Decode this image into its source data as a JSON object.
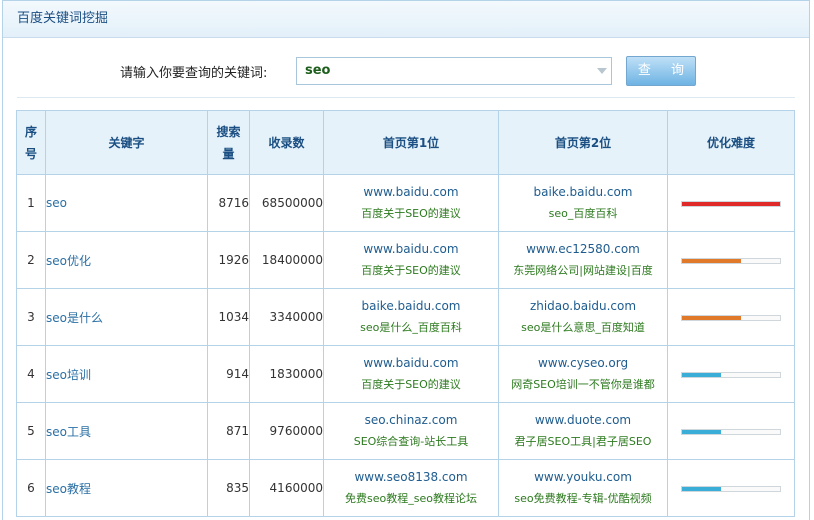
{
  "header": {
    "title": "百度关键词挖掘"
  },
  "search": {
    "label": "请输入你要查询的关键词:",
    "value": "seo",
    "button_label": "查 询"
  },
  "table": {
    "columns": [
      "序号",
      "关键字",
      "搜索量",
      "收录数",
      "首页第1位",
      "首页第2位",
      "优化难度"
    ],
    "rows": [
      {
        "index": "1",
        "keyword": "seo",
        "search_volume": "8716",
        "indexed": "68500000",
        "first_domain": "www.baidu.com",
        "first_title": "百度关于SEO的建议",
        "second_domain": "baike.baidu.com",
        "second_title": "seo_百度百科",
        "difficulty": 1.0,
        "difficulty_color": "#e02a2a"
      },
      {
        "index": "2",
        "keyword": "seo优化",
        "search_volume": "1926",
        "indexed": "18400000",
        "first_domain": "www.baidu.com",
        "first_title": "百度关于SEO的建议",
        "second_domain": "www.ec12580.com",
        "second_title": "东莞网络公司|网站建设|百度",
        "difficulty": 0.6,
        "difficulty_color": "#e07a2a"
      },
      {
        "index": "3",
        "keyword": "seo是什么",
        "search_volume": "1034",
        "indexed": "3340000",
        "first_domain": "baike.baidu.com",
        "first_title": "seo是什么_百度百科",
        "second_domain": "zhidao.baidu.com",
        "second_title": "seo是什么意思_百度知道",
        "difficulty": 0.6,
        "difficulty_color": "#e07a2a"
      },
      {
        "index": "4",
        "keyword": "seo培训",
        "search_volume": "914",
        "indexed": "1830000",
        "first_domain": "www.baidu.com",
        "first_title": "百度关于SEO的建议",
        "second_domain": "www.cyseo.org",
        "second_title": "网奇SEO培训一不管你是谁都",
        "difficulty": 0.4,
        "difficulty_color": "#3aaed6"
      },
      {
        "index": "5",
        "keyword": "seo工具",
        "search_volume": "871",
        "indexed": "9760000",
        "first_domain": "seo.chinaz.com",
        "first_title": "SEO综合查询-站长工具",
        "second_domain": "www.duote.com",
        "second_title": "君子居SEO工具|君子居SEO",
        "difficulty": 0.4,
        "difficulty_color": "#3aaed6"
      },
      {
        "index": "6",
        "keyword": "seo教程",
        "search_volume": "835",
        "indexed": "4160000",
        "first_domain": "www.seo8138.com",
        "first_title": "免费seo教程_seo教程论坛",
        "second_domain": "www.youku.com",
        "second_title": "seo免费教程-专辑-优酷视频",
        "difficulty": 0.4,
        "difficulty_color": "#3aaed6"
      }
    ]
  }
}
